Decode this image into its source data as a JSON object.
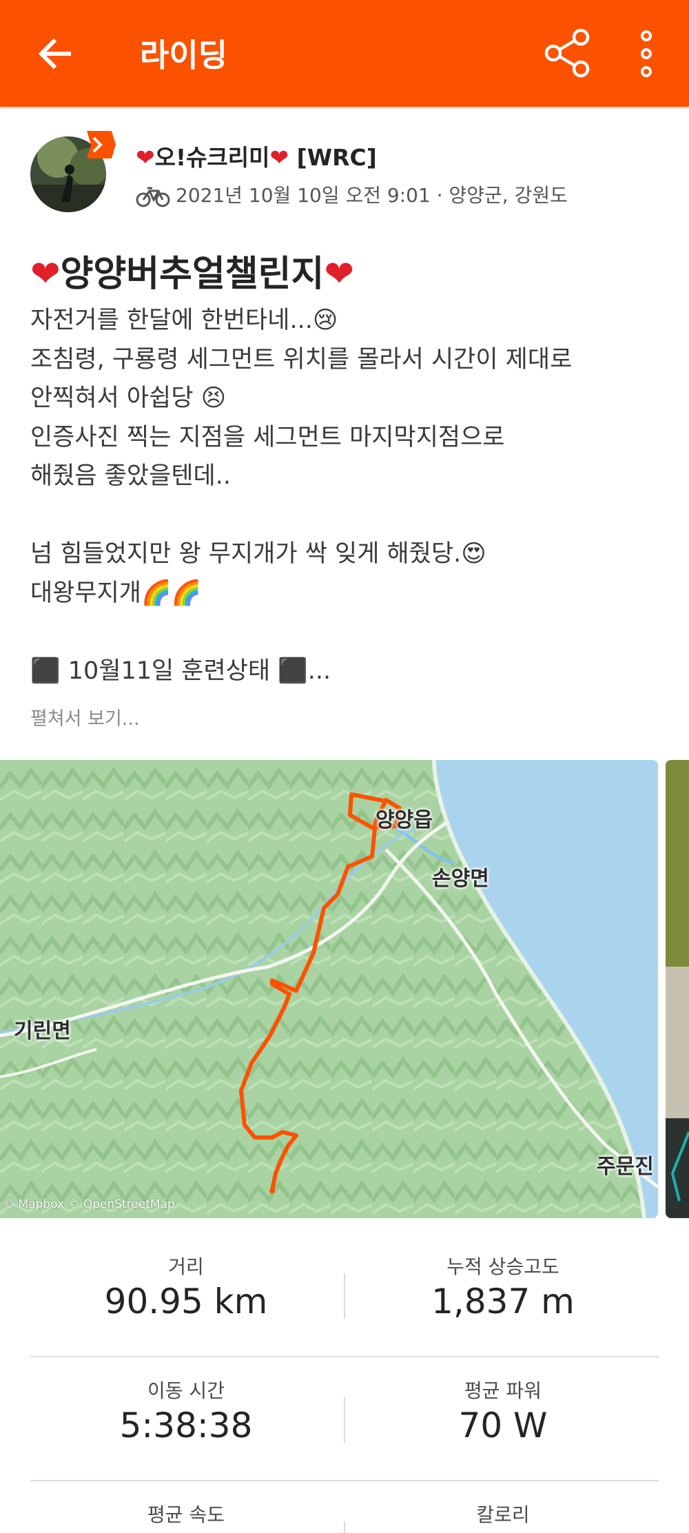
{
  "appbar": {
    "title": "라이딩",
    "accent_color": "#fc5200",
    "icons": [
      "back-arrow-icon",
      "share-icon",
      "more-vertical-icon"
    ]
  },
  "athlete": {
    "name_prefix": "❤",
    "name_main": "오!슈크리미",
    "name_suffix": "❤",
    "club": " [WRC]",
    "date": "2021년 10월 10일 오전 9:01 · 양양군, 강원도",
    "activity_icon": "bike-icon"
  },
  "activity": {
    "title_prefix": "❤",
    "title_main": "양양버추얼챌린지",
    "title_suffix": "❤",
    "description": [
      "자전거를 한달에 한번타네...😢",
      "조침령, 구룡령 세그먼트 위치를 몰라서 시간이 제대로",
      "안찍혀서 아쉽당 😣",
      "인증사진 찍는 지점을 세그먼트 마지막지점으로",
      "해줬음 좋았을텐데..",
      "",
      "넘 힘들었지만 왕 무지개가 싹 잊게 해줬당.😍",
      "대왕무지개🌈🌈",
      "",
      "⬛ 10월11일 훈련상태 ⬛..."
    ],
    "expand_link": "펼쳐서 보기..."
  },
  "map": {
    "labels": {
      "yangyang": "양양읍",
      "sonyang": "손양면",
      "girin": "기린면",
      "jumunjin": "주문진"
    },
    "attribution": "© Mapbox © OpenStreetMap",
    "route_color": "#fc5200"
  },
  "stats": [
    {
      "label": "거리",
      "value": "90.95 km"
    },
    {
      "label": "누적 상승고도",
      "value": "1,837 m"
    },
    {
      "label": "이동 시간",
      "value": "5:38:38"
    },
    {
      "label": "평균 파워",
      "value": "70 W"
    },
    {
      "label": "평균 속도",
      "value": ""
    },
    {
      "label": "칼로리",
      "value": ""
    }
  ]
}
